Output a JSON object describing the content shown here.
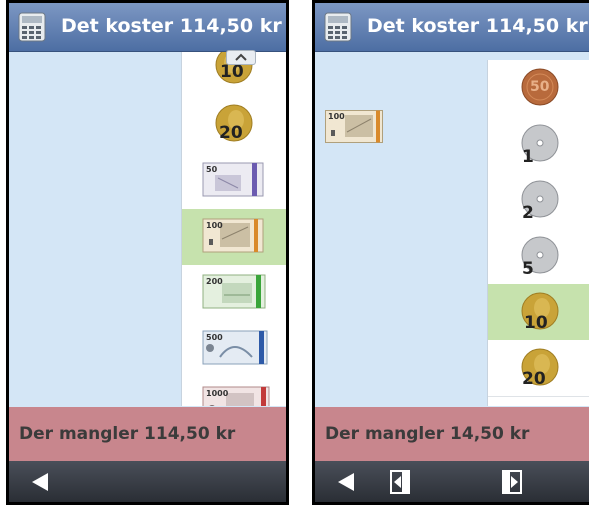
{
  "left": {
    "title": "Det koster 114,50 kr",
    "items": [
      "10",
      "20",
      "50",
      "100",
      "200",
      "500",
      "1000"
    ],
    "status": "Der mangler 114,50 kr"
  },
  "right": {
    "title": "Det koster 114,50 kr",
    "placed_note": "100",
    "items": [
      "50",
      "1",
      "2",
      "5",
      "10",
      "20"
    ],
    "status": "Der mangler 14,50 kr"
  },
  "colors": {
    "title_bar": "#5d7db0",
    "area": "#d4e6f6",
    "selected": "#c6e2ad",
    "status_bar": "#c8868d",
    "nav_bar": "#333840"
  },
  "icons": {
    "app": "calculator-icon",
    "back": "back-arrow-icon",
    "prev": "previous-page-icon",
    "next": "next-page-icon",
    "scroll_up": "chevron-up-icon"
  }
}
